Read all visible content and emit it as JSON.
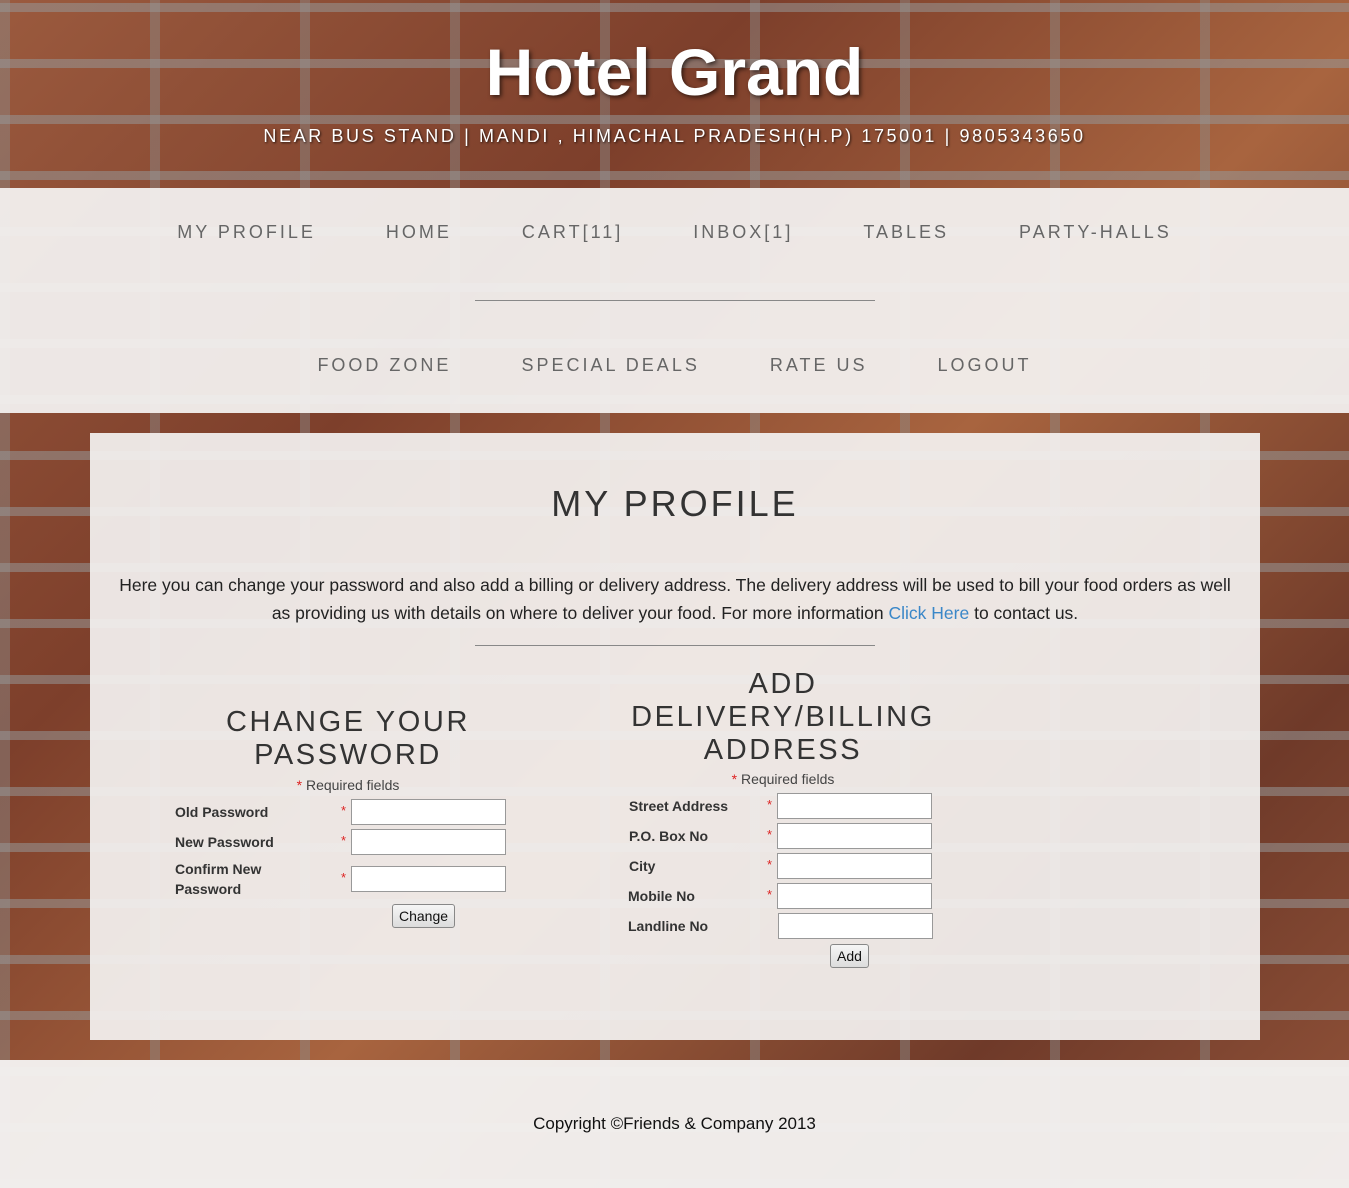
{
  "header": {
    "title": "Hotel Grand",
    "address": "NEAR BUS STAND | MANDI , HIMACHAL PRADESH(H.P) 175001 | 9805343650"
  },
  "nav": {
    "row1": [
      "MY PROFILE",
      "HOME",
      "CART[11]",
      "INBOX[1]",
      "TABLES",
      "PARTY-HALLS"
    ],
    "row2": [
      "FOOD ZONE",
      "SPECIAL DEALS",
      "RATE US",
      "LOGOUT"
    ]
  },
  "main": {
    "title": "MY PROFILE",
    "intro_text_1": "Here you can change your password and also add a billing or delivery address. The delivery address will be used to bill your food orders as well as providing us with details on where to deliver your food. For more information ",
    "intro_link": "Click Here",
    "intro_text_2": " to contact us."
  },
  "password_form": {
    "heading_line1": "CHANGE YOUR",
    "heading_line2": "PASSWORD",
    "required_star": "*",
    "required_note": " Required fields",
    "fields": {
      "old_password": "Old Password",
      "new_password": "New Password",
      "confirm_line1": "Confirm New",
      "confirm_line2": "Password"
    },
    "submit_label": "Change"
  },
  "address_form": {
    "heading_line1": "ADD",
    "heading_line2": "DELIVERY/BILLING",
    "heading_line3": "ADDRESS",
    "required_star": "*",
    "required_note": " Required fields",
    "fields": {
      "street": "Street Address",
      "po_box": "P.O. Box No",
      "city": "City",
      "mobile": "Mobile No",
      "landline": "Landline No"
    },
    "submit_label": "Add"
  },
  "footer": {
    "copyright": "Copyright ©Friends & Company 2013"
  }
}
